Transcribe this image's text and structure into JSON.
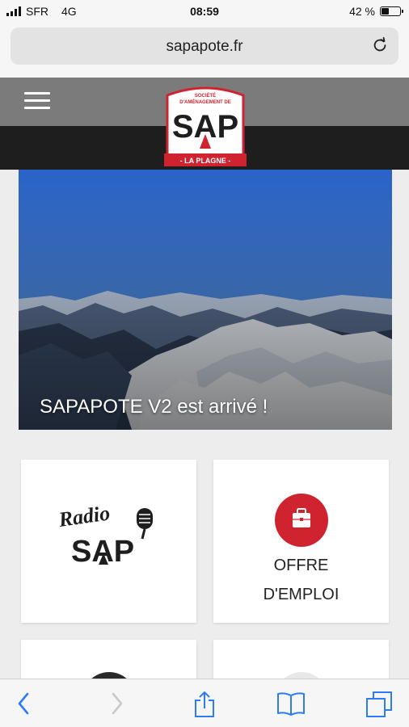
{
  "status_bar": {
    "carrier": "SFR",
    "network": "4G",
    "time": "08:59",
    "battery": "42 %",
    "battery_level": 0.42
  },
  "browser": {
    "url": "sapapote.fr",
    "reload_icon": "reload-icon"
  },
  "site_header": {
    "menu_icon": "hamburger-menu-icon",
    "logo": {
      "top_text": "SOCIÉTÉ D'AMÉNAGEMENT DE",
      "main_text": "SAP",
      "bottom_text": "- LA PLAGNE -",
      "accent": "#cf2430"
    }
  },
  "hero": {
    "caption": "SAPAPOTE V2 est arrivé !"
  },
  "cards": [
    {
      "name": "radio-sap",
      "logo_line1": "Radio",
      "logo_line2": "SAP"
    },
    {
      "name": "job-offer",
      "icon": "briefcase-icon",
      "line1": "OFFRE",
      "line2": "D'EMPLOI",
      "icon_bg": "#cf2430"
    }
  ],
  "toolbar": {
    "back": "back-icon",
    "forward": "forward-icon",
    "share": "share-icon",
    "bookmarks": "bookmarks-icon",
    "tabs": "tabs-icon",
    "accent": "#2b7cf6"
  }
}
